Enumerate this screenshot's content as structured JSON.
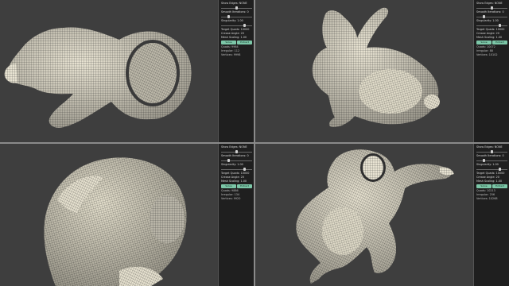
{
  "viewports": [
    {
      "id": "horn",
      "panel": {
        "label1": "Show Edges: NONE",
        "label2": "Smooth Iterations: 0",
        "label3": "Singularity: 1.00",
        "label4": "Target Quads: 10000",
        "label5": "Crease Angle: 20",
        "label6": "Mesh Scaling: 1.00",
        "button_primary": "Solve",
        "button_secondary": "Extract",
        "stat1": "Quads: 9964",
        "stat2": "Irregular: 112",
        "stat3": "Vertices: 9998"
      }
    },
    {
      "id": "bunny",
      "panel": {
        "label1": "Show Edges: NONE",
        "label2": "Smooth Iterations: 0",
        "label3": "Singularity: 1.00",
        "label4": "Target Quads: 10000",
        "label5": "Crease Angle: 20",
        "label6": "Mesh Scaling: 1.00",
        "button_primary": "Solve",
        "button_secondary": "Extract",
        "stat1": "Quads: 10072",
        "stat2": "Irregular: 88",
        "stat3": "Vertices: 10102"
      }
    },
    {
      "id": "head",
      "panel": {
        "label1": "Show Edges: NONE",
        "label2": "Smooth Iterations: 0",
        "label3": "Singularity: 1.00",
        "label4": "Target Quads: 10000",
        "label5": "Crease Angle: 20",
        "label6": "Mesh Scaling: 1.00",
        "button_primary": "Solve",
        "button_secondary": "Extract",
        "stat1": "Quads: 9886",
        "stat2": "Irregular: 134",
        "stat3": "Vertices: 9920"
      }
    },
    {
      "id": "armadillo",
      "panel": {
        "label1": "Show Edges: NONE",
        "label2": "Smooth Iterations: 0",
        "label3": "Singularity: 1.00",
        "label4": "Target Quads: 10000",
        "label5": "Crease Angle: 20",
        "label6": "Mesh Scaling: 1.00",
        "button_primary": "Solve",
        "button_secondary": "Extract",
        "stat1": "Quads: 10213",
        "stat2": "Irregular: 256",
        "stat3": "Vertices: 10268"
      }
    }
  ],
  "colors": {
    "background": "#3e3e3e",
    "panel": "#1f1f1f",
    "mesh_fill": "#e8e3d2",
    "mesh_lines": "#2e2e2e",
    "accent": "#7cc7a8"
  }
}
